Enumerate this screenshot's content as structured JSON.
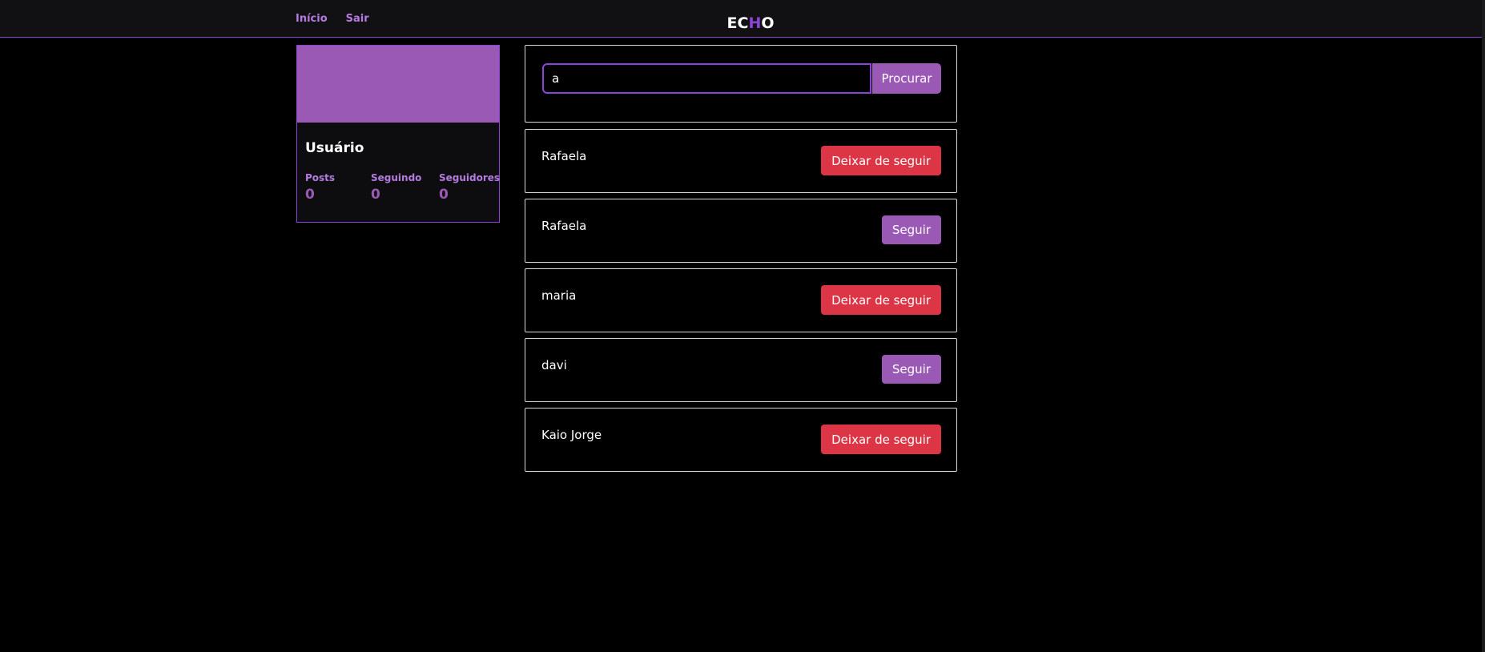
{
  "nav": {
    "links": [
      "Início",
      "Sair"
    ],
    "brand": [
      "E",
      "C",
      "H",
      "O"
    ]
  },
  "profile": {
    "name": "Usuário",
    "stats": [
      {
        "label": "Posts",
        "value": "0"
      },
      {
        "label": "Seguindo",
        "value": "0"
      },
      {
        "label": "Seguidores",
        "value": "0"
      }
    ]
  },
  "search": {
    "value": "a",
    "button_label": "Procurar"
  },
  "results": [
    {
      "name": "Rafaela",
      "action": "Deixar de seguir",
      "following": true
    },
    {
      "name": "Rafaela",
      "action": "Seguir",
      "following": false
    },
    {
      "name": "maria",
      "action": "Deixar de seguir",
      "following": true
    },
    {
      "name": "davi",
      "action": "Seguir",
      "following": false
    },
    {
      "name": "Kaio Jorge",
      "action": "Deixar de seguir",
      "following": true
    }
  ],
  "colors": {
    "accent": "#9b59b6",
    "accent_border": "#8b44d8",
    "danger": "#dc3545",
    "background": "#000000"
  }
}
